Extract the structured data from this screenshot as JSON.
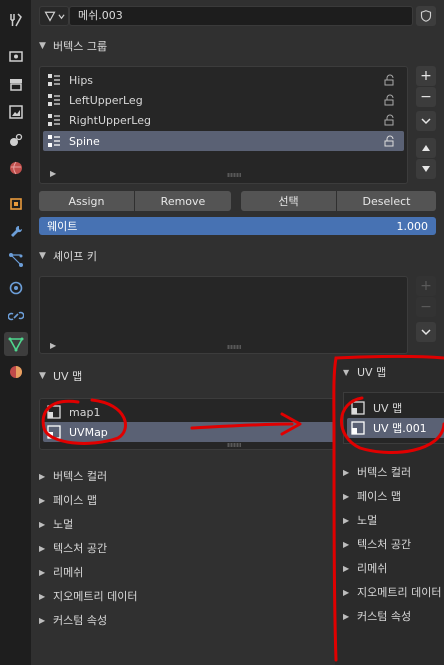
{
  "header": {
    "object_name": "메쉬.003"
  },
  "vertex_groups": {
    "title": "버텍스 그룹",
    "items": [
      {
        "label": "Hips",
        "selected": false
      },
      {
        "label": "LeftUpperLeg",
        "selected": false
      },
      {
        "label": "RightUpperLeg",
        "selected": false
      },
      {
        "label": "Spine",
        "selected": true
      }
    ],
    "buttons": {
      "assign": "Assign",
      "remove": "Remove",
      "select": "선택",
      "deselect": "Deselect"
    },
    "weight": {
      "label": "웨이트",
      "value": "1.000"
    }
  },
  "shape_keys": {
    "title": "셰이프 키"
  },
  "uv_maps": {
    "title": "UV 맵",
    "items": [
      {
        "label": "map1",
        "selected": false
      },
      {
        "label": "UVMap",
        "selected": true
      }
    ]
  },
  "collapsed_panels": [
    "버텍스 컬러",
    "페이스 맵",
    "노멀",
    "텍스처 공간",
    "리메쉬",
    "지오메트리 데이터",
    "커스텀 속성"
  ],
  "overlay_after": {
    "title": "UV 맵",
    "items": [
      {
        "label": "UV 맵",
        "selected": false
      },
      {
        "label": "UV 맵.001",
        "selected": true
      }
    ],
    "panels": [
      "버텍스 컬러",
      "페이스 맵",
      "노멀",
      "텍스처 공간",
      "리메쉬",
      "지오메트리 데이터",
      "커스텀 속성"
    ]
  },
  "colors": {
    "accent": "#4772b3",
    "selection": "#5a6174",
    "annotation": "#e00000"
  },
  "icons": [
    "tool-icon",
    "render-icon",
    "output-icon",
    "view-layer-icon",
    "scene-icon",
    "world-icon",
    "object-icon",
    "modifier-icon",
    "particles-icon",
    "physics-icon",
    "constraints-icon",
    "mesh-data-icon",
    "material-icon"
  ]
}
